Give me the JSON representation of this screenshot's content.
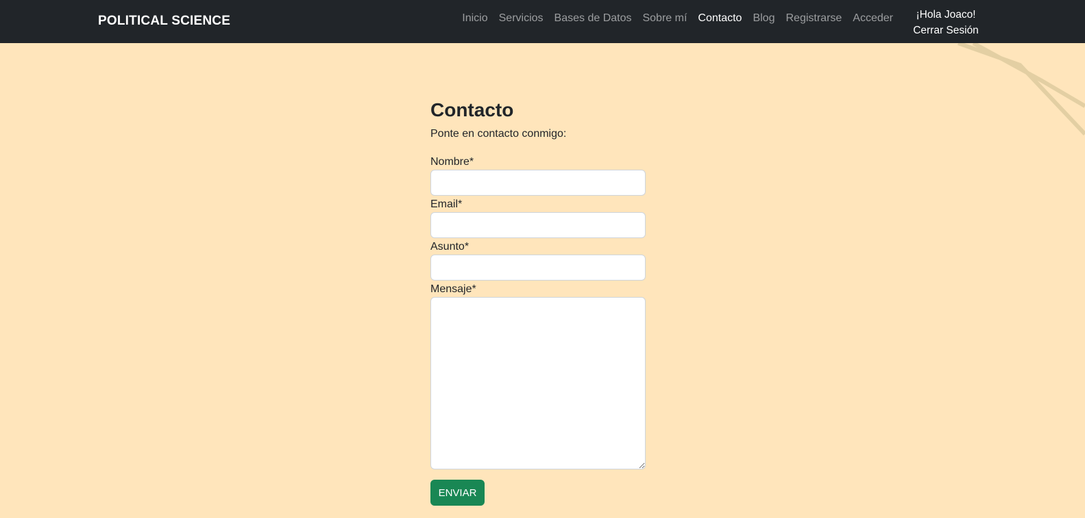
{
  "navbar": {
    "brand": "POLITICAL SCIENCE",
    "links": [
      {
        "label": "Inicio",
        "active": false
      },
      {
        "label": "Servicios",
        "active": false
      },
      {
        "label": "Bases de Datos",
        "active": false
      },
      {
        "label": "Sobre mí",
        "active": false
      },
      {
        "label": "Contacto",
        "active": true
      },
      {
        "label": "Blog",
        "active": false
      },
      {
        "label": "Registrarse",
        "active": false
      },
      {
        "label": "Acceder",
        "active": false
      }
    ],
    "greeting": "¡Hola Joaco!",
    "logout": "Cerrar Sesión"
  },
  "main": {
    "title": "Contacto",
    "intro": "Ponte en contacto conmigo:",
    "form": {
      "name_label": "Nombre*",
      "name_value": "",
      "email_label": "Email*",
      "email_value": "",
      "subject_label": "Asunto*",
      "subject_value": "",
      "message_label": "Mensaje*",
      "message_value": "",
      "submit_label": "ENVIAR"
    }
  },
  "colors": {
    "page_background": "#ffe5bb",
    "navbar_background": "#212529",
    "submit_button": "#198754"
  }
}
